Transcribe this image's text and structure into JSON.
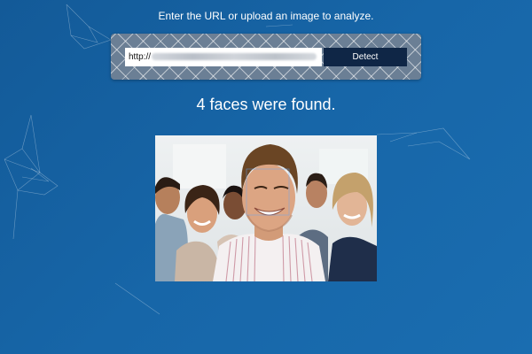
{
  "instruction": "Enter the URL or upload an image to analyze.",
  "url_input": {
    "value": "http://"
  },
  "detect_button": {
    "label": "Detect"
  },
  "result": {
    "text": "4 faces were found."
  },
  "photo": {
    "subject": "group of smiling people, man in striped shirt in front",
    "faces_detected": 4
  },
  "colors": {
    "background": "#1766a8",
    "panel": "#6b7f95",
    "button": "#0f2646",
    "text": "#ffffff"
  }
}
